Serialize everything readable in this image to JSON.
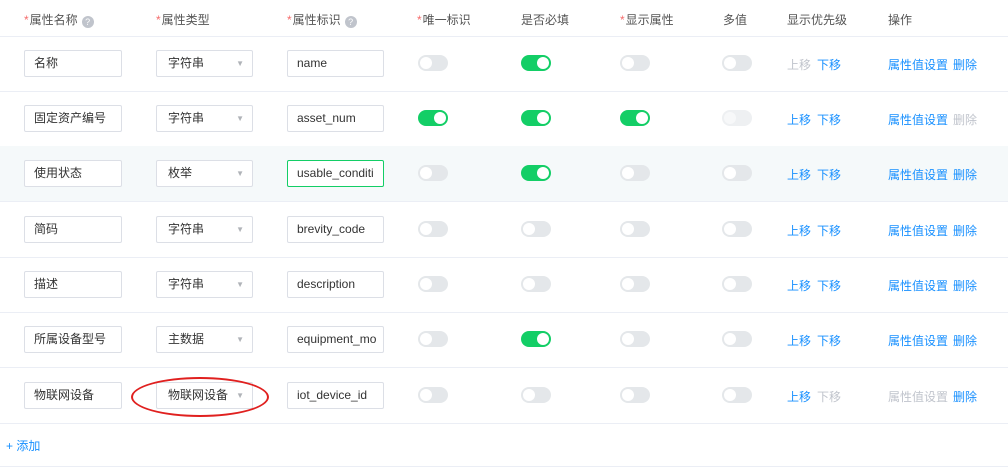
{
  "header": {
    "name": "属性名称",
    "type": "属性类型",
    "identifier": "属性标识",
    "unique": "唯一标识",
    "required": "是否必填",
    "display": "显示属性",
    "multi": "多值",
    "priority": "显示优先级",
    "actions": "操作",
    "required_marker": "*",
    "help_icon": "?"
  },
  "rows": [
    {
      "name": "名称",
      "type": "字符串",
      "ident": "name",
      "unique": "off",
      "required": "on",
      "display": "off",
      "multi": "off",
      "up": "上移",
      "up_enabled": false,
      "down": "下移",
      "down_enabled": true,
      "settings": "属性值设置",
      "settings_enabled": true,
      "del": "删除",
      "del_enabled": true
    },
    {
      "name": "固定资产编号",
      "type": "字符串",
      "ident": "asset_num",
      "unique": "on",
      "required": "on",
      "display": "on",
      "multi": "disabled",
      "up": "上移",
      "up_enabled": true,
      "down": "下移",
      "down_enabled": true,
      "settings": "属性值设置",
      "settings_enabled": true,
      "del": "删除",
      "del_enabled": false
    },
    {
      "name": "使用状态",
      "type": "枚举",
      "ident": "usable_conditi",
      "unique": "off",
      "required": "on",
      "display": "off",
      "multi": "off",
      "up": "上移",
      "up_enabled": true,
      "down": "下移",
      "down_enabled": true,
      "settings": "属性值设置",
      "settings_enabled": true,
      "del": "删除",
      "del_enabled": true
    },
    {
      "name": "简码",
      "type": "字符串",
      "ident": "brevity_code",
      "unique": "off",
      "required": "off",
      "display": "off",
      "multi": "off",
      "up": "上移",
      "up_enabled": true,
      "down": "下移",
      "down_enabled": true,
      "settings": "属性值设置",
      "settings_enabled": true,
      "del": "删除",
      "del_enabled": true
    },
    {
      "name": "描述",
      "type": "字符串",
      "ident": "description",
      "unique": "off",
      "required": "off",
      "display": "off",
      "multi": "off",
      "up": "上移",
      "up_enabled": true,
      "down": "下移",
      "down_enabled": true,
      "settings": "属性值设置",
      "settings_enabled": true,
      "del": "删除",
      "del_enabled": true
    },
    {
      "name": "所属设备型号",
      "type": "主数据",
      "ident": "equipment_mo",
      "unique": "off",
      "required": "on",
      "display": "off",
      "multi": "off",
      "up": "上移",
      "up_enabled": true,
      "down": "下移",
      "down_enabled": true,
      "settings": "属性值设置",
      "settings_enabled": true,
      "del": "删除",
      "del_enabled": true
    },
    {
      "name": "物联网设备",
      "type": "物联网设备",
      "ident": "iot_device_id",
      "unique": "off",
      "required": "off",
      "display": "off",
      "multi": "off",
      "up": "上移",
      "up_enabled": true,
      "down": "下移",
      "down_enabled": false,
      "settings": "属性值设置",
      "settings_enabled": false,
      "del": "删除",
      "del_enabled": true
    }
  ],
  "add_label": "+ 添加",
  "colors": {
    "accent": "#1890ff",
    "switch_on": "#13ce66",
    "required_star": "#f56c6c",
    "annotation": "#e0201f"
  }
}
